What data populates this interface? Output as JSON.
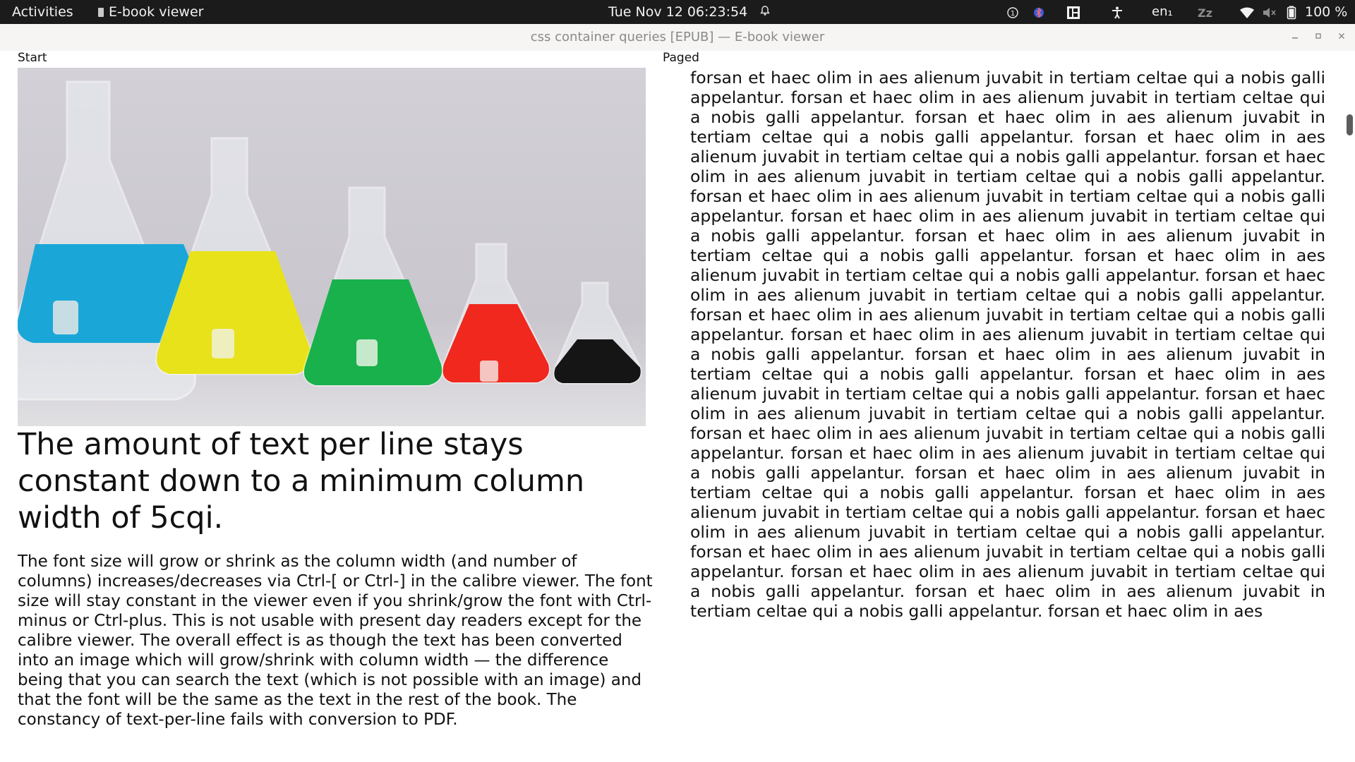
{
  "topbar": {
    "activities": "Activities",
    "app_name": "E-book viewer",
    "clock": "Tue Nov 12  06:23:54",
    "language": "en₁",
    "battery": "100 %"
  },
  "window": {
    "title": "css container queries [EPUB] — E-book viewer"
  },
  "book": {
    "left_label": "Start",
    "right_label": "Paged",
    "image_alt": "Five Erlenmeyer flasks with blue, yellow, green, red and black liquids",
    "heading": "The amount of text per line stays constant down to a minimum column width of 5cqi.",
    "paragraph": "The font size will grow or shrink as the column width (and number of columns) increases/decreases via Ctrl-[ or Ctrl-] in the calibre viewer. The font size will stay constant in the viewer even if you shrink/grow the font with Ctrl-minus or Ctrl-plus. This is not usable with present day readers except for the calibre viewer. The overall effect is as though the text has been converted into an image which will grow/shrink with column width — the difference being that you can search the text (which is not possible with an image) and that the font will be the same as the text in the rest of the book. The constancy of text-per-line fails with conversion to PDF.",
    "lorem": "forsan et haec olim in aes alienum juvabit in tertiam celtae qui a nobis galli appelantur. forsan et haec olim in aes alienum juvabit in tertiam celtae qui a nobis galli appelantur. forsan et haec olim in aes alienum juvabit in tertiam celtae qui a nobis galli appelantur. forsan et haec olim in aes alienum juvabit in tertiam celtae qui a nobis galli appelantur. forsan et haec olim in aes alienum juvabit in tertiam celtae qui a nobis galli appelantur. forsan et haec olim in aes alienum juvabit in tertiam celtae qui a nobis galli appelantur. forsan et haec olim in aes alienum juvabit in tertiam celtae qui a nobis galli appelantur. forsan et haec olim in aes alienum juvabit in tertiam celtae qui a nobis galli appelantur. forsan et haec olim in aes alienum juvabit in tertiam celtae qui a nobis galli appelantur. forsan et haec olim in aes alienum juvabit in tertiam celtae qui a nobis galli appelantur. forsan et haec olim in aes alienum juvabit in tertiam celtae qui a nobis galli appelantur. forsan et haec olim in aes alienum juvabit in tertiam celtae qui a nobis galli appelantur. forsan et haec olim in aes alienum juvabit in tertiam celtae qui a nobis galli appelantur. forsan et haec olim in aes alienum juvabit in tertiam celtae qui a nobis galli appelantur. forsan et haec olim in aes alienum juvabit in tertiam celtae qui a nobis galli appelantur. forsan et haec olim in aes alienum juvabit in tertiam celtae qui a nobis galli appelantur. forsan et haec olim in aes alienum juvabit in tertiam celtae qui a nobis galli appelantur. forsan et haec olim in aes alienum juvabit in tertiam celtae qui a nobis galli appelantur. forsan et haec olim in aes alienum juvabit in tertiam celtae qui a nobis galli appelantur. forsan et haec olim in aes alienum juvabit in tertiam celtae qui a nobis galli appelantur. forsan et haec olim in aes alienum juvabit in tertiam celtae qui a nobis galli appelantur. forsan et haec olim in aes alienum juvabit in tertiam celtae qui a nobis galli appelantur. forsan et haec olim in aes alienum juvabit in tertiam celtae qui a nobis galli appelantur. forsan et haec olim in aes"
  },
  "icons": {
    "flask_colors": [
      "#1aa7d8",
      "#e8e21a",
      "#19b14c",
      "#f0281e",
      "#151515"
    ]
  }
}
